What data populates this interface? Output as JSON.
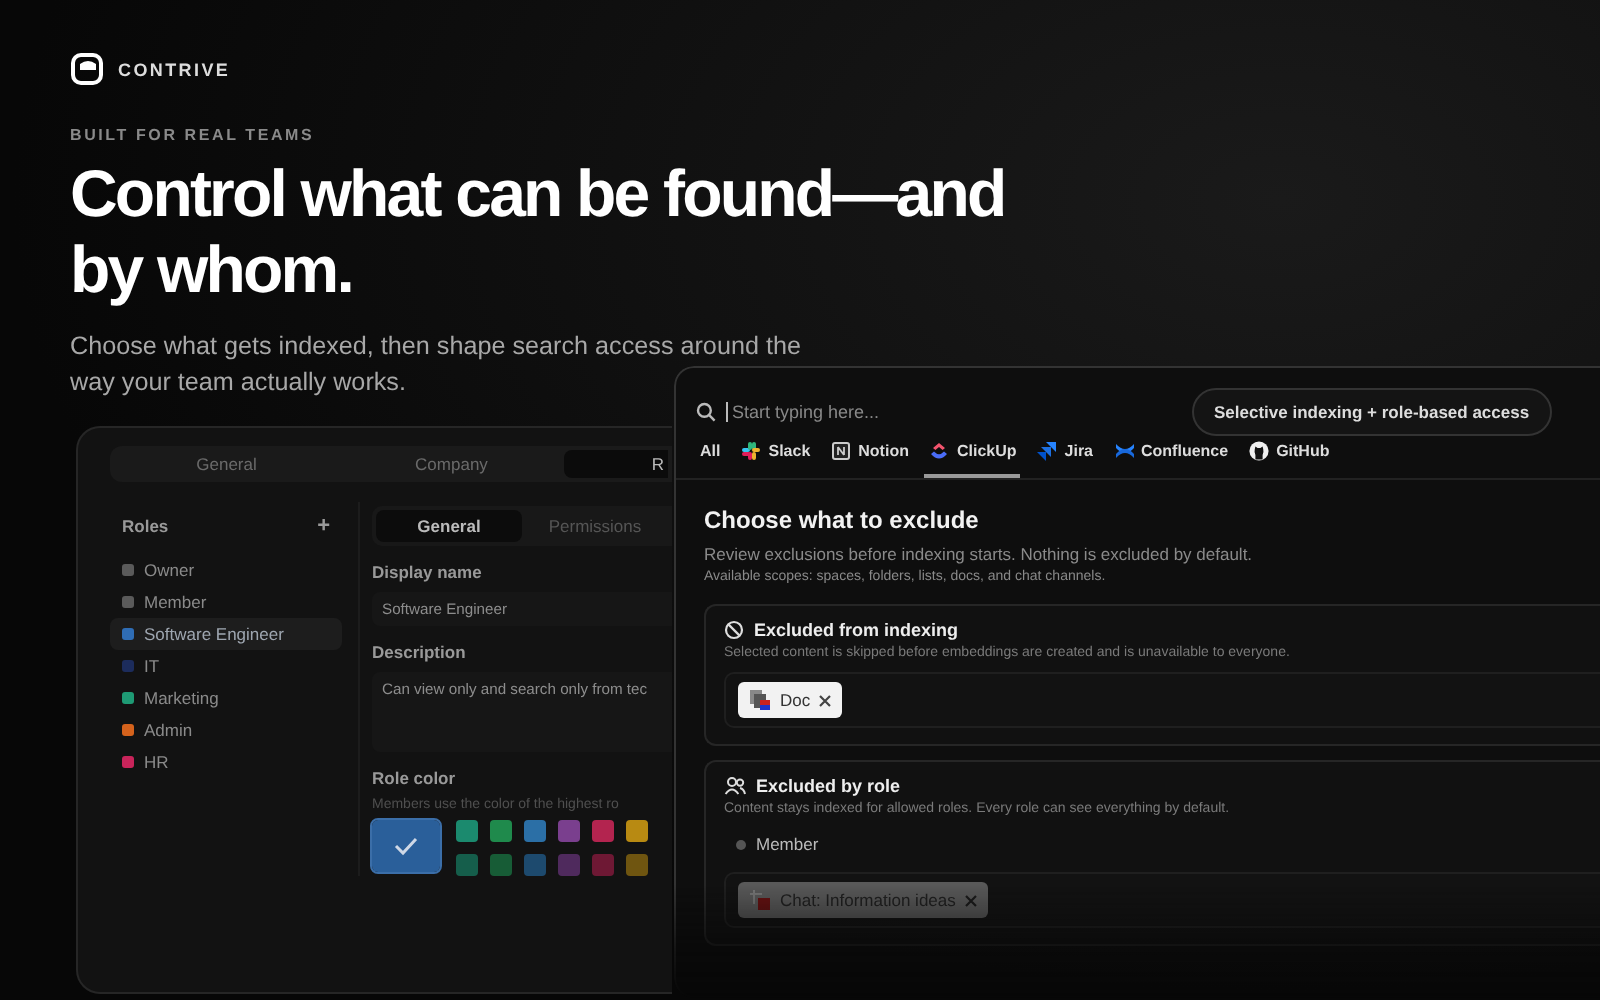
{
  "brand": {
    "name": "CONTRIVE"
  },
  "hero": {
    "eyebrow": "BUILT FOR REAL TEAMS",
    "headline": "Control what can be found—and by whom.",
    "subtitle": "Choose what gets indexed, then shape search access around the way your team actually works."
  },
  "settings_window": {
    "tabs": [
      {
        "label": "General",
        "selected": false
      },
      {
        "label": "Company",
        "selected": false
      },
      {
        "label": "R",
        "selected": true
      }
    ],
    "roles": {
      "title": "Roles",
      "add": "+",
      "items": [
        {
          "name": "Owner",
          "color": "#5a5a5a",
          "selected": false
        },
        {
          "name": "Member",
          "color": "#5a5a5a",
          "selected": false
        },
        {
          "name": "Software Engineer",
          "color": "#2f6db5",
          "selected": true
        },
        {
          "name": "IT",
          "color": "#1c2c5c",
          "selected": false
        },
        {
          "name": "Marketing",
          "color": "#1e9a74",
          "selected": false
        },
        {
          "name": "Admin",
          "color": "#d4621c",
          "selected": false
        },
        {
          "name": "HR",
          "color": "#c8245a",
          "selected": false
        }
      ]
    },
    "subtabs": [
      {
        "label": "General",
        "selected": true
      },
      {
        "label": "Permissions",
        "selected": false
      }
    ],
    "display_name": {
      "label": "Display name",
      "value": "Software Engineer"
    },
    "description": {
      "label": "Description",
      "value": "Can view only and search only from tec"
    },
    "role_color": {
      "label": "Role color",
      "hint": "Members use the color of the highest ro",
      "swatches": [
        {
          "color": "#2a5f9a",
          "selected": true
        },
        {
          "color": "#1b8a6e",
          "selected": false
        },
        {
          "color": "#1f8a4c",
          "selected": false
        },
        {
          "color": "#2b6fa6",
          "selected": false
        },
        {
          "color": "#7a3f8e",
          "selected": false
        },
        {
          "color": "#b3244f",
          "selected": false
        },
        {
          "color": "#b88a12",
          "selected": false
        },
        {
          "color": "#155e4b",
          "selected": false
        },
        {
          "color": "#175c36",
          "selected": false
        },
        {
          "color": "#1d4a6e",
          "selected": false
        },
        {
          "color": "#4f2a5d",
          "selected": false
        },
        {
          "color": "#6e1834",
          "selected": false
        },
        {
          "color": "#6f5510",
          "selected": false
        }
      ]
    }
  },
  "search_window": {
    "search": {
      "placeholder": "Start typing here..."
    },
    "badge": "Selective indexing + role-based access",
    "sources": [
      {
        "label": "All",
        "kind": "all",
        "selected": false
      },
      {
        "label": "Slack",
        "kind": "slack",
        "selected": false
      },
      {
        "label": "Notion",
        "kind": "notion",
        "selected": false
      },
      {
        "label": "ClickUp",
        "kind": "clickup",
        "selected": true
      },
      {
        "label": "Jira",
        "kind": "jira",
        "selected": false
      },
      {
        "label": "Confluence",
        "kind": "confluence",
        "selected": false
      },
      {
        "label": "GitHub",
        "kind": "github",
        "selected": false
      }
    ],
    "heading": "Choose what to exclude",
    "description": "Review exclusions before indexing starts. Nothing is excluded by default.",
    "scopes": "Available scopes: spaces, folders, lists, docs, and chat channels.",
    "sections": [
      {
        "kind": "indexing",
        "title": "Excluded from indexing",
        "description": "Selected content is skipped before embeddings are created and is unavailable to everyone.",
        "tags": [
          {
            "label": "Doc",
            "kind": "doc"
          }
        ]
      },
      {
        "kind": "role",
        "title": "Excluded by role",
        "description": "Content stays indexed for allowed roles. Every role can see everything by default.",
        "role": "Member",
        "tags": [
          {
            "label": "Chat: Information ideas",
            "kind": "chat"
          }
        ]
      }
    ]
  }
}
